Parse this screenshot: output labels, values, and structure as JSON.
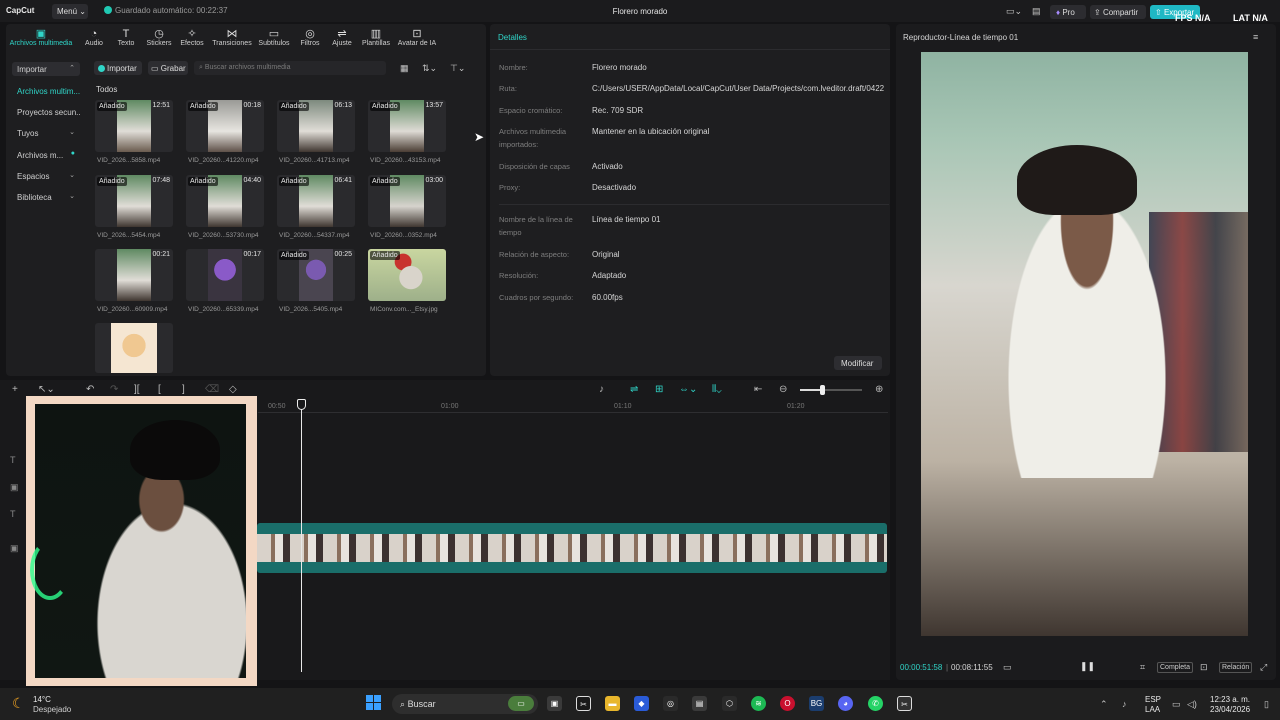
{
  "app": {
    "logo": "CapCut",
    "menu_label": "Menú",
    "autosave": "Guardado automático: 00:22:37",
    "project_title": "Florero morado",
    "pro_label": "Pro",
    "share_label": "Compartir",
    "export_label": "Exportar",
    "fps_label": "FPS N/A",
    "lat_label": "LAT N/A",
    "accent_color": "#30d5c8"
  },
  "toolbar": [
    {
      "label": "Archivos multimedia",
      "icon": "media-icon"
    },
    {
      "label": "Audio",
      "icon": "audio-icon"
    },
    {
      "label": "Texto",
      "icon": "text-icon"
    },
    {
      "label": "Stickers",
      "icon": "sticker-icon"
    },
    {
      "label": "Efectos",
      "icon": "effects-icon"
    },
    {
      "label": "Transiciones",
      "icon": "transition-icon"
    },
    {
      "label": "Subtítulos",
      "icon": "captions-icon"
    },
    {
      "label": "Filtros",
      "icon": "filter-icon"
    },
    {
      "label": "Ajuste",
      "icon": "adjust-icon"
    },
    {
      "label": "Plantillas",
      "icon": "templates-icon"
    },
    {
      "label": "Avatar de IA",
      "icon": "avatar-icon"
    }
  ],
  "sidebar": [
    {
      "label": "Importar"
    },
    {
      "label": "Archivos multim..."
    },
    {
      "label": "Proyectos secun..."
    },
    {
      "label": "Tuyos"
    },
    {
      "label": "Archivos m..."
    },
    {
      "label": "Espacios"
    },
    {
      "label": "Biblioteca"
    }
  ],
  "media": {
    "import_label": "Importar",
    "record_label": "Grabar",
    "search_placeholder": "Buscar archivos multimedia",
    "section_label": "Todos",
    "added_label": "Añadido",
    "items": [
      {
        "name": "VID_2026...5858.mp4",
        "duration": "12:51",
        "added": true
      },
      {
        "name": "VID_20260...41220.mp4",
        "duration": "00:18",
        "added": true
      },
      {
        "name": "VID_20260...41713.mp4",
        "duration": "06:13",
        "added": true
      },
      {
        "name": "VID_20260...43153.mp4",
        "duration": "13:57",
        "added": true
      },
      {
        "name": "VID_2026...5454.mp4",
        "duration": "07:48",
        "added": true
      },
      {
        "name": "VID_20260...53730.mp4",
        "duration": "04:40",
        "added": true
      },
      {
        "name": "VID_20260...54337.mp4",
        "duration": "06:41",
        "added": true
      },
      {
        "name": "VID_20260...0352.mp4",
        "duration": "03:00",
        "added": true
      },
      {
        "name": "VID_20260...60909.mp4",
        "duration": "00:21",
        "added": false
      },
      {
        "name": "VID_20260...65339.mp4",
        "duration": "00:17",
        "added": false
      },
      {
        "name": "VID_2026...5405.mp4",
        "duration": "00:25",
        "added": true
      },
      {
        "name": "MIConv.com..._Etsy.jpg",
        "duration": "",
        "added": true
      },
      {
        "name": "",
        "duration": "",
        "added": false
      }
    ]
  },
  "details": {
    "title": "Detalles",
    "rows": [
      {
        "label": "Nombre:",
        "value": "Florero morado"
      },
      {
        "label": "Ruta:",
        "value": "C:/Users/USER/AppData/Local/CapCut/User Data/Projects/com.lveditor.draft/0422"
      },
      {
        "label": "Espacio cromático:",
        "value": "Rec. 709 SDR"
      },
      {
        "label": "Archivos multimedia importados:",
        "value": "Mantener en la ubicación original"
      },
      {
        "label": "Disposición de capas",
        "value": "Activado"
      },
      {
        "label": "Proxy:",
        "value": "Desactivado"
      },
      {
        "label": "Nombre de la línea de tiempo",
        "value": "Línea de tiempo 01"
      },
      {
        "label": "Relación de aspecto:",
        "value": "Original"
      },
      {
        "label": "Resolución:",
        "value": "Adaptado"
      },
      {
        "label": "Cuadros por segundo:",
        "value": "60.00fps"
      }
    ],
    "modify_label": "Modificar"
  },
  "player": {
    "title": "Reproductor-Línea de tiempo 01",
    "current_time": "00:00:51:58",
    "total_time": "00:08:11:55",
    "full_label": "Completa",
    "ratio_label": "Relación"
  },
  "timeline": {
    "ticks": [
      "00:50",
      "01:00",
      "01:10",
      "01:20"
    ]
  },
  "taskbar": {
    "temperature": "14°C",
    "weather": "Despejado",
    "search_label": "Buscar",
    "lang_1": "ESP",
    "lang_2": "LAA",
    "time": "12:23 a. m.",
    "date": "23/04/2026"
  }
}
